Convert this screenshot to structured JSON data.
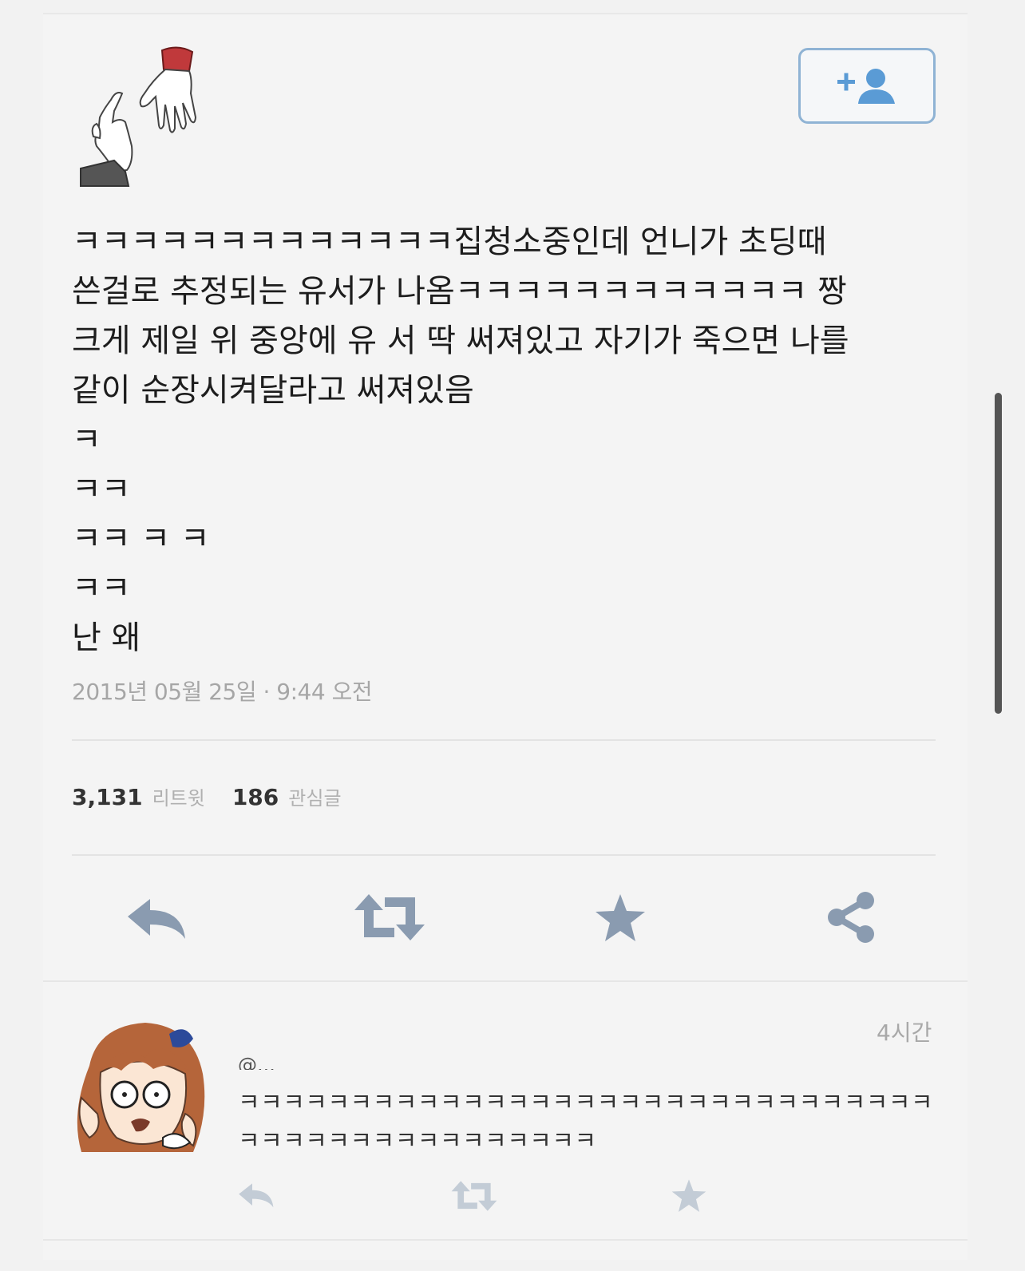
{
  "tweet": {
    "text_lines": [
      "ㅋㅋㅋㅋㅋㅋㅋㅋㅋㅋㅋㅋㅋ집청소중인데 언니가 초딩때",
      "쓴걸로 추정되는 유서가 나옴ㅋㅋㅋㅋㅋㅋㅋㅋㅋㅋㅋㅋ 짱",
      "크게 제일 위 중앙에 유 서 딱 써져있고 자기가 죽으면 나를",
      "같이 순장시켜달라고 써져있음",
      "ㅋ",
      "ㅋㅋ",
      "ㅋㅋ ㅋ ㅋ",
      "ㅋㅋ",
      "난 왜"
    ],
    "timestamp": "2015년 05월 25일 · 9:44 오전"
  },
  "stats": {
    "retweets": "3,131",
    "retweets_label": "리트윗",
    "favorites": "186",
    "favorites_label": "관심글"
  },
  "reply": {
    "time": "4시간",
    "handle": "@...",
    "text": "ㅋㅋㅋㅋㅋㅋㅋㅋㅋㅋㅋㅋㅋㅋㅋㅋㅋㅋㅋㅋㅋㅋㅋㅋㅋㅋㅋㅋㅋㅋㅋㅋㅋㅋㅋㅋㅋㅋㅋㅋㅋㅋㅋㅋㅋㅋㅋ"
  },
  "colors": {
    "icon": "#8a9bb0",
    "icon_light": "#c3ccd6",
    "follow_border": "#8fb3d4",
    "follow_icon": "#5a9bd5"
  }
}
